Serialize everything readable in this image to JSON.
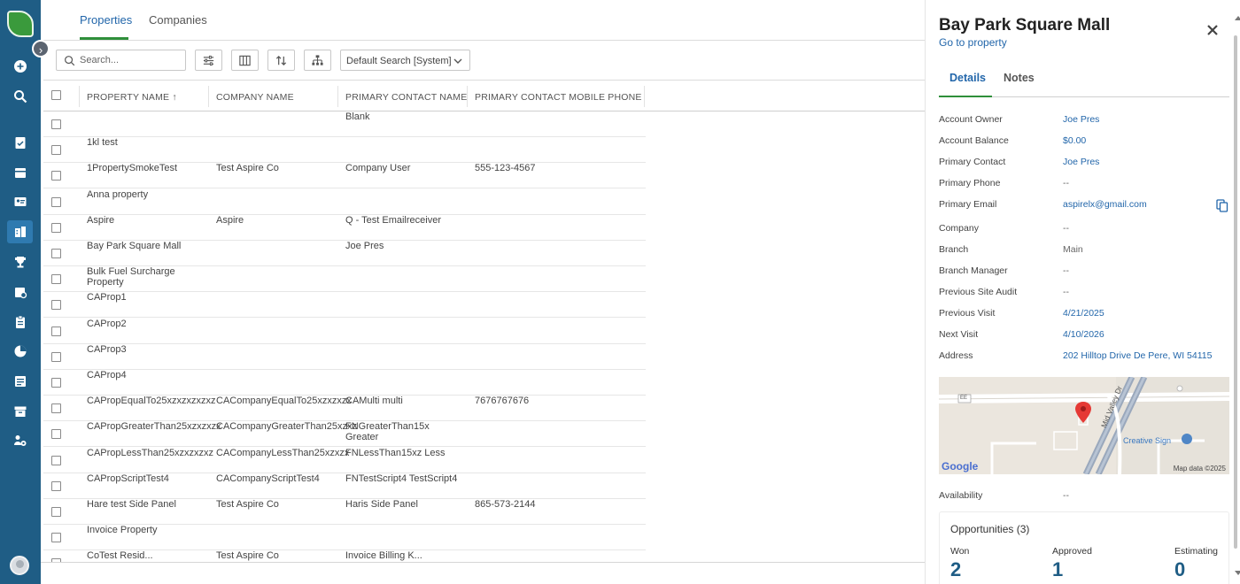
{
  "nav": {
    "icons": [
      "plus-circle-icon",
      "search-icon",
      "clipboard-check-icon",
      "calendar-icon",
      "contact-card-icon",
      "properties-icon",
      "trophy-icon",
      "calendar-settings-icon",
      "clipboard-icon",
      "pie-chart-icon",
      "report-icon",
      "archive-icon",
      "people-gear-icon"
    ]
  },
  "tabs": [
    "Properties",
    "Companies"
  ],
  "toolbar": {
    "search_placeholder": "Search...",
    "saved_search": "Default Search [System]"
  },
  "grid": {
    "columns": [
      "PROPERTY NAME",
      "COMPANY NAME",
      "PRIMARY CONTACT NAME",
      "PRIMARY CONTACT MOBILE PHONE"
    ],
    "sort_indicator": "↑",
    "rows": [
      [
        "",
        "",
        "Blank",
        ""
      ],
      [
        "1kl test",
        "",
        "",
        ""
      ],
      [
        "1PropertySmokeTest",
        "Test Aspire Co",
        "Company User",
        "555-123-4567"
      ],
      [
        "Anna property",
        "",
        "",
        ""
      ],
      [
        "Aspire",
        "Aspire",
        "Q - Test Emailreceiver",
        ""
      ],
      [
        "Bay Park Square Mall",
        "",
        "Joe Pres",
        ""
      ],
      [
        "Bulk Fuel Surcharge Property",
        "",
        "",
        ""
      ],
      [
        "CAProp1",
        "",
        "",
        ""
      ],
      [
        "CAProp2",
        "",
        "",
        ""
      ],
      [
        "CAProp3",
        "",
        "",
        ""
      ],
      [
        "CAProp4",
        "",
        "",
        ""
      ],
      [
        "CAPropEqualTo25xzxzxzxzxz",
        "CACompanyEqualTo25xzxzxzx",
        "CAMulti multi",
        "7676767676"
      ],
      [
        "CAPropGreaterThan25xzxzxzx",
        "CACompanyGreaterThan25xzxz",
        "FNGreaterThan15x Greater",
        ""
      ],
      [
        "CAPropLessThan25xzxzxzxz",
        "CACompanyLessThan25xzxzx",
        "FNLessThan15xz Less",
        ""
      ],
      [
        "CAPropScriptTest4",
        "CACompanyScriptTest4",
        "FNTestScript4 TestScript4",
        ""
      ],
      [
        "Hare test Side Panel",
        "Test Aspire Co",
        "Haris Side Panel",
        "865-573-2144"
      ],
      [
        "Invoice Property",
        "",
        "",
        ""
      ],
      [
        "CoTest Resid...",
        "Test Aspire Co",
        "Invoice Billing K...",
        ""
      ]
    ]
  },
  "panel": {
    "title": "Bay Park Square Mall",
    "go_to_link": "Go to property",
    "tabs": [
      "Details",
      "Notes"
    ],
    "details": [
      {
        "label": "Account Owner",
        "value": "Joe Pres",
        "link": true
      },
      {
        "label": "Account Balance",
        "value": "$0.00",
        "link": true
      },
      {
        "label": "Primary Contact",
        "value": "Joe Pres",
        "link": true
      },
      {
        "label": "Primary Phone",
        "value": "--",
        "link": false
      },
      {
        "label": "Primary Email",
        "value": "aspirelx@gmail.com",
        "link": true
      },
      {
        "label": "Company",
        "value": "--",
        "link": false
      },
      {
        "label": "Branch",
        "value": "Main",
        "link": false
      },
      {
        "label": "Branch Manager",
        "value": "--",
        "link": false
      },
      {
        "label": "Previous Site Audit",
        "value": "--",
        "link": false
      },
      {
        "label": "Previous Visit",
        "value": "4/21/2025",
        "link": true
      },
      {
        "label": "Next Visit",
        "value": "4/10/2026",
        "link": true
      },
      {
        "label": "Address",
        "value": "202 Hilltop Drive De Pere, WI 54115",
        "link": true
      }
    ],
    "map": {
      "road_label": "Mid Valley Dr",
      "place_label": "Creative Sign",
      "road_shield": "EE",
      "google": "Google",
      "attribution": "Map data ©2025"
    },
    "availability": {
      "label": "Availability",
      "value": "--"
    },
    "opportunities": {
      "title": "Opportunities (3)",
      "stats": [
        {
          "label": "Won",
          "value": "2"
        },
        {
          "label": "Approved",
          "value": "1"
        },
        {
          "label": "Estimating",
          "value": "0"
        }
      ]
    }
  },
  "colors": {
    "rail": "#1f5d85",
    "link": "#2266aa",
    "accent_green": "#2f8f3a",
    "stat": "#1f5d85"
  }
}
